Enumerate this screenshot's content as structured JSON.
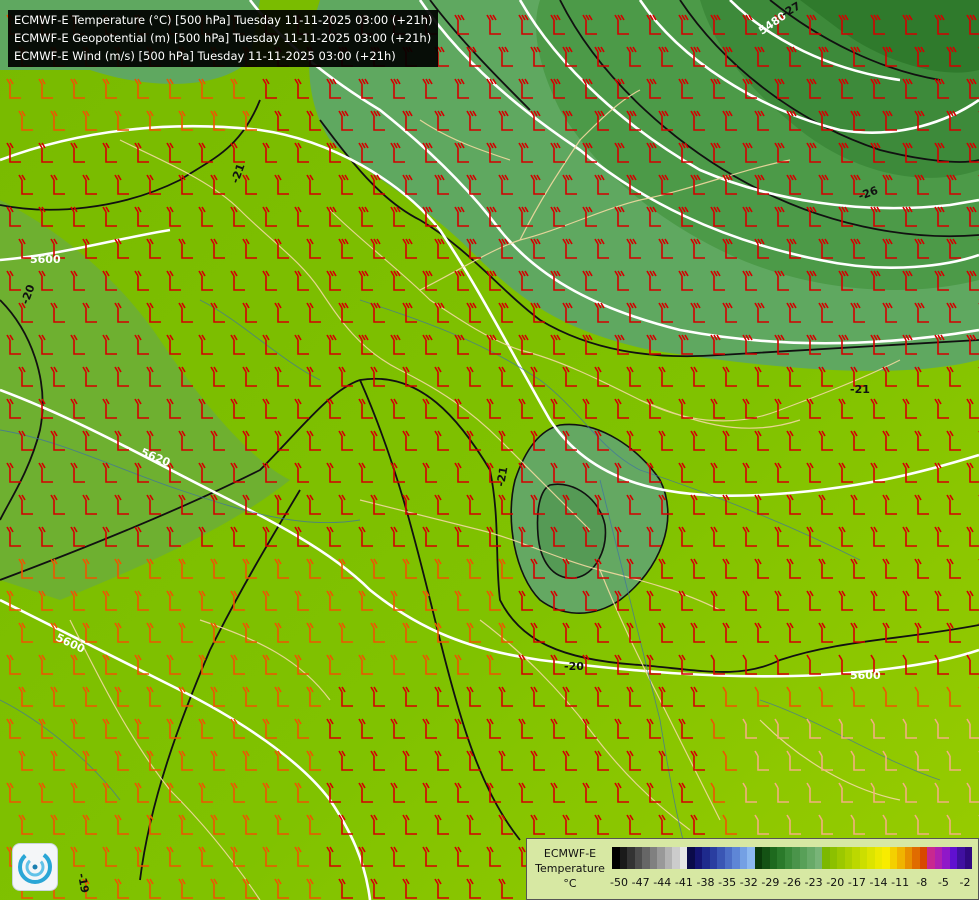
{
  "legend": {
    "lines": [
      "ECMWF-E Temperature (°C) [500 hPa] Tuesday 11-11-2025 03:00 (+21h)",
      "ECMWF-E Geopotential (m) [500 hPa] Tuesday 11-11-2025 03:00 (+21h)",
      "ECMWF-E Wind (m/s) [500 hPa] Tuesday 11-11-2025 03:00 (+21h)"
    ]
  },
  "geopotential_labels": [
    "5600",
    "5620",
    "5600",
    "5600",
    "5480"
  ],
  "temperature_labels": [
    "-20",
    "-21",
    "-21",
    "-20",
    "-21",
    "-19",
    "-27",
    "-26"
  ],
  "colorbar": {
    "title_lines": [
      "ECMWF-E",
      "Temperature",
      "°C"
    ],
    "ticks": [
      "-50",
      "-47",
      "-44",
      "-41",
      "-38",
      "-35",
      "-32",
      "-29",
      "-26",
      "-23",
      "-20",
      "-17",
      "-14",
      "-11",
      "-8",
      "-5",
      "-2"
    ],
    "colors": [
      "#000000",
      "#1a1a1a",
      "#333333",
      "#4d4d4d",
      "#666666",
      "#808080",
      "#999999",
      "#b3b3b3",
      "#cccccc",
      "#e6e6e6",
      "#0a0a4a",
      "#141472",
      "#1e2a8c",
      "#2a3ea0",
      "#3a56b4",
      "#4c6ec6",
      "#5e86d6",
      "#74a0e4",
      "#8cb8f0",
      "#0a3a0a",
      "#145214",
      "#1e6a1e",
      "#2a7a2a",
      "#3a8a3a",
      "#4a944a",
      "#58a058",
      "#68aa68",
      "#78b478",
      "#7cb800",
      "#8cc000",
      "#9cc800",
      "#acd000",
      "#bcd800",
      "#ccde00",
      "#dce400",
      "#ecea00",
      "#f8ec00",
      "#f4d000",
      "#f0b400",
      "#e89000",
      "#e06c00",
      "#d84800",
      "#c82890",
      "#b020b0",
      "#9018c8",
      "#6010d0",
      "#4010a0",
      "#300880"
    ],
    "accent_outline": "#555555"
  },
  "map_colors": {
    "warm_field": "#7fc000",
    "field_light": "#9ccc00",
    "cold_core_outer": "#5fa64a",
    "cold_core_mid": "#4f9a46",
    "cold_core_inner": "#3c8a38",
    "trough_small": "#62a861",
    "contour_black": "#111111",
    "geopotential_white": "#ffffff",
    "wind_strong": "#d40000",
    "wind_mid": "#ee5500",
    "wind_weak": "#f2b080",
    "border": "#f4dca0",
    "river": "#3c6ea8"
  }
}
